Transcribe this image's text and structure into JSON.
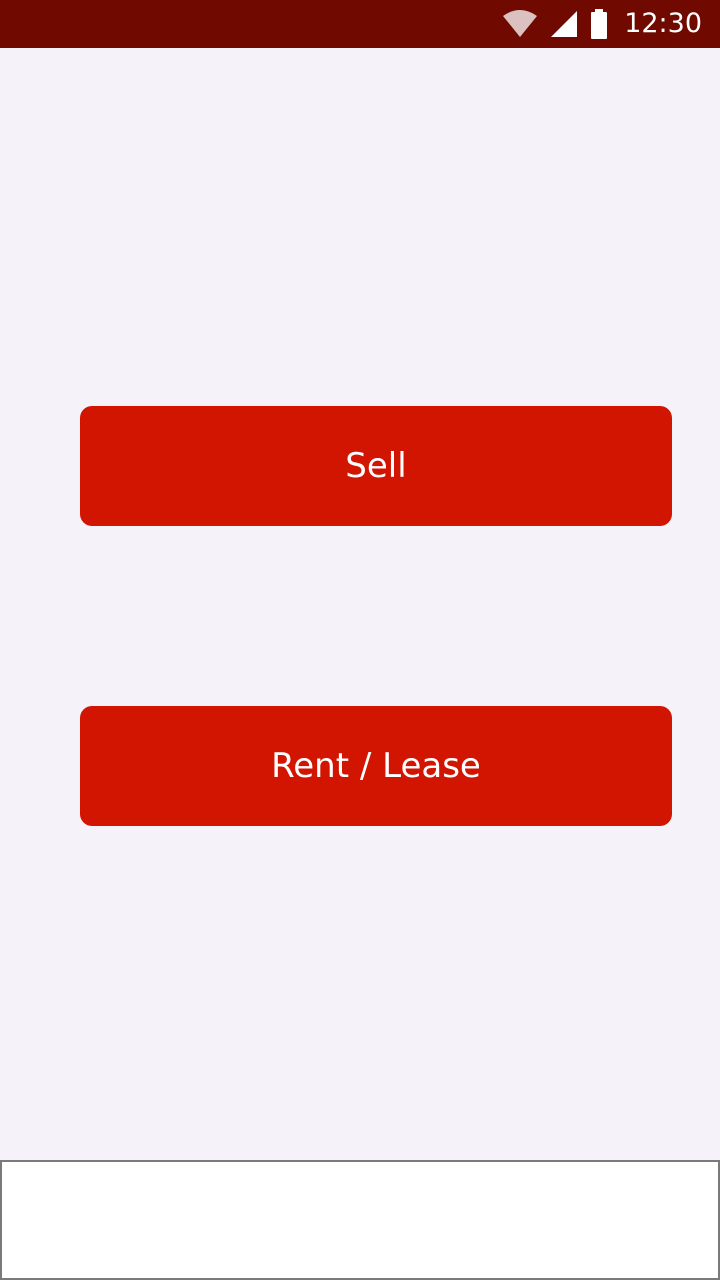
{
  "status_bar": {
    "time": "12:30",
    "background_color": "#700a00",
    "icons": [
      "wifi-icon",
      "cellular-signal-icon",
      "battery-icon"
    ]
  },
  "main": {
    "background_color": "#f5f3f9",
    "buttons": [
      {
        "label": "Sell"
      },
      {
        "label": "Rent / Lease"
      }
    ],
    "button_color": "#d11500",
    "button_text_color": "#ffffff"
  }
}
